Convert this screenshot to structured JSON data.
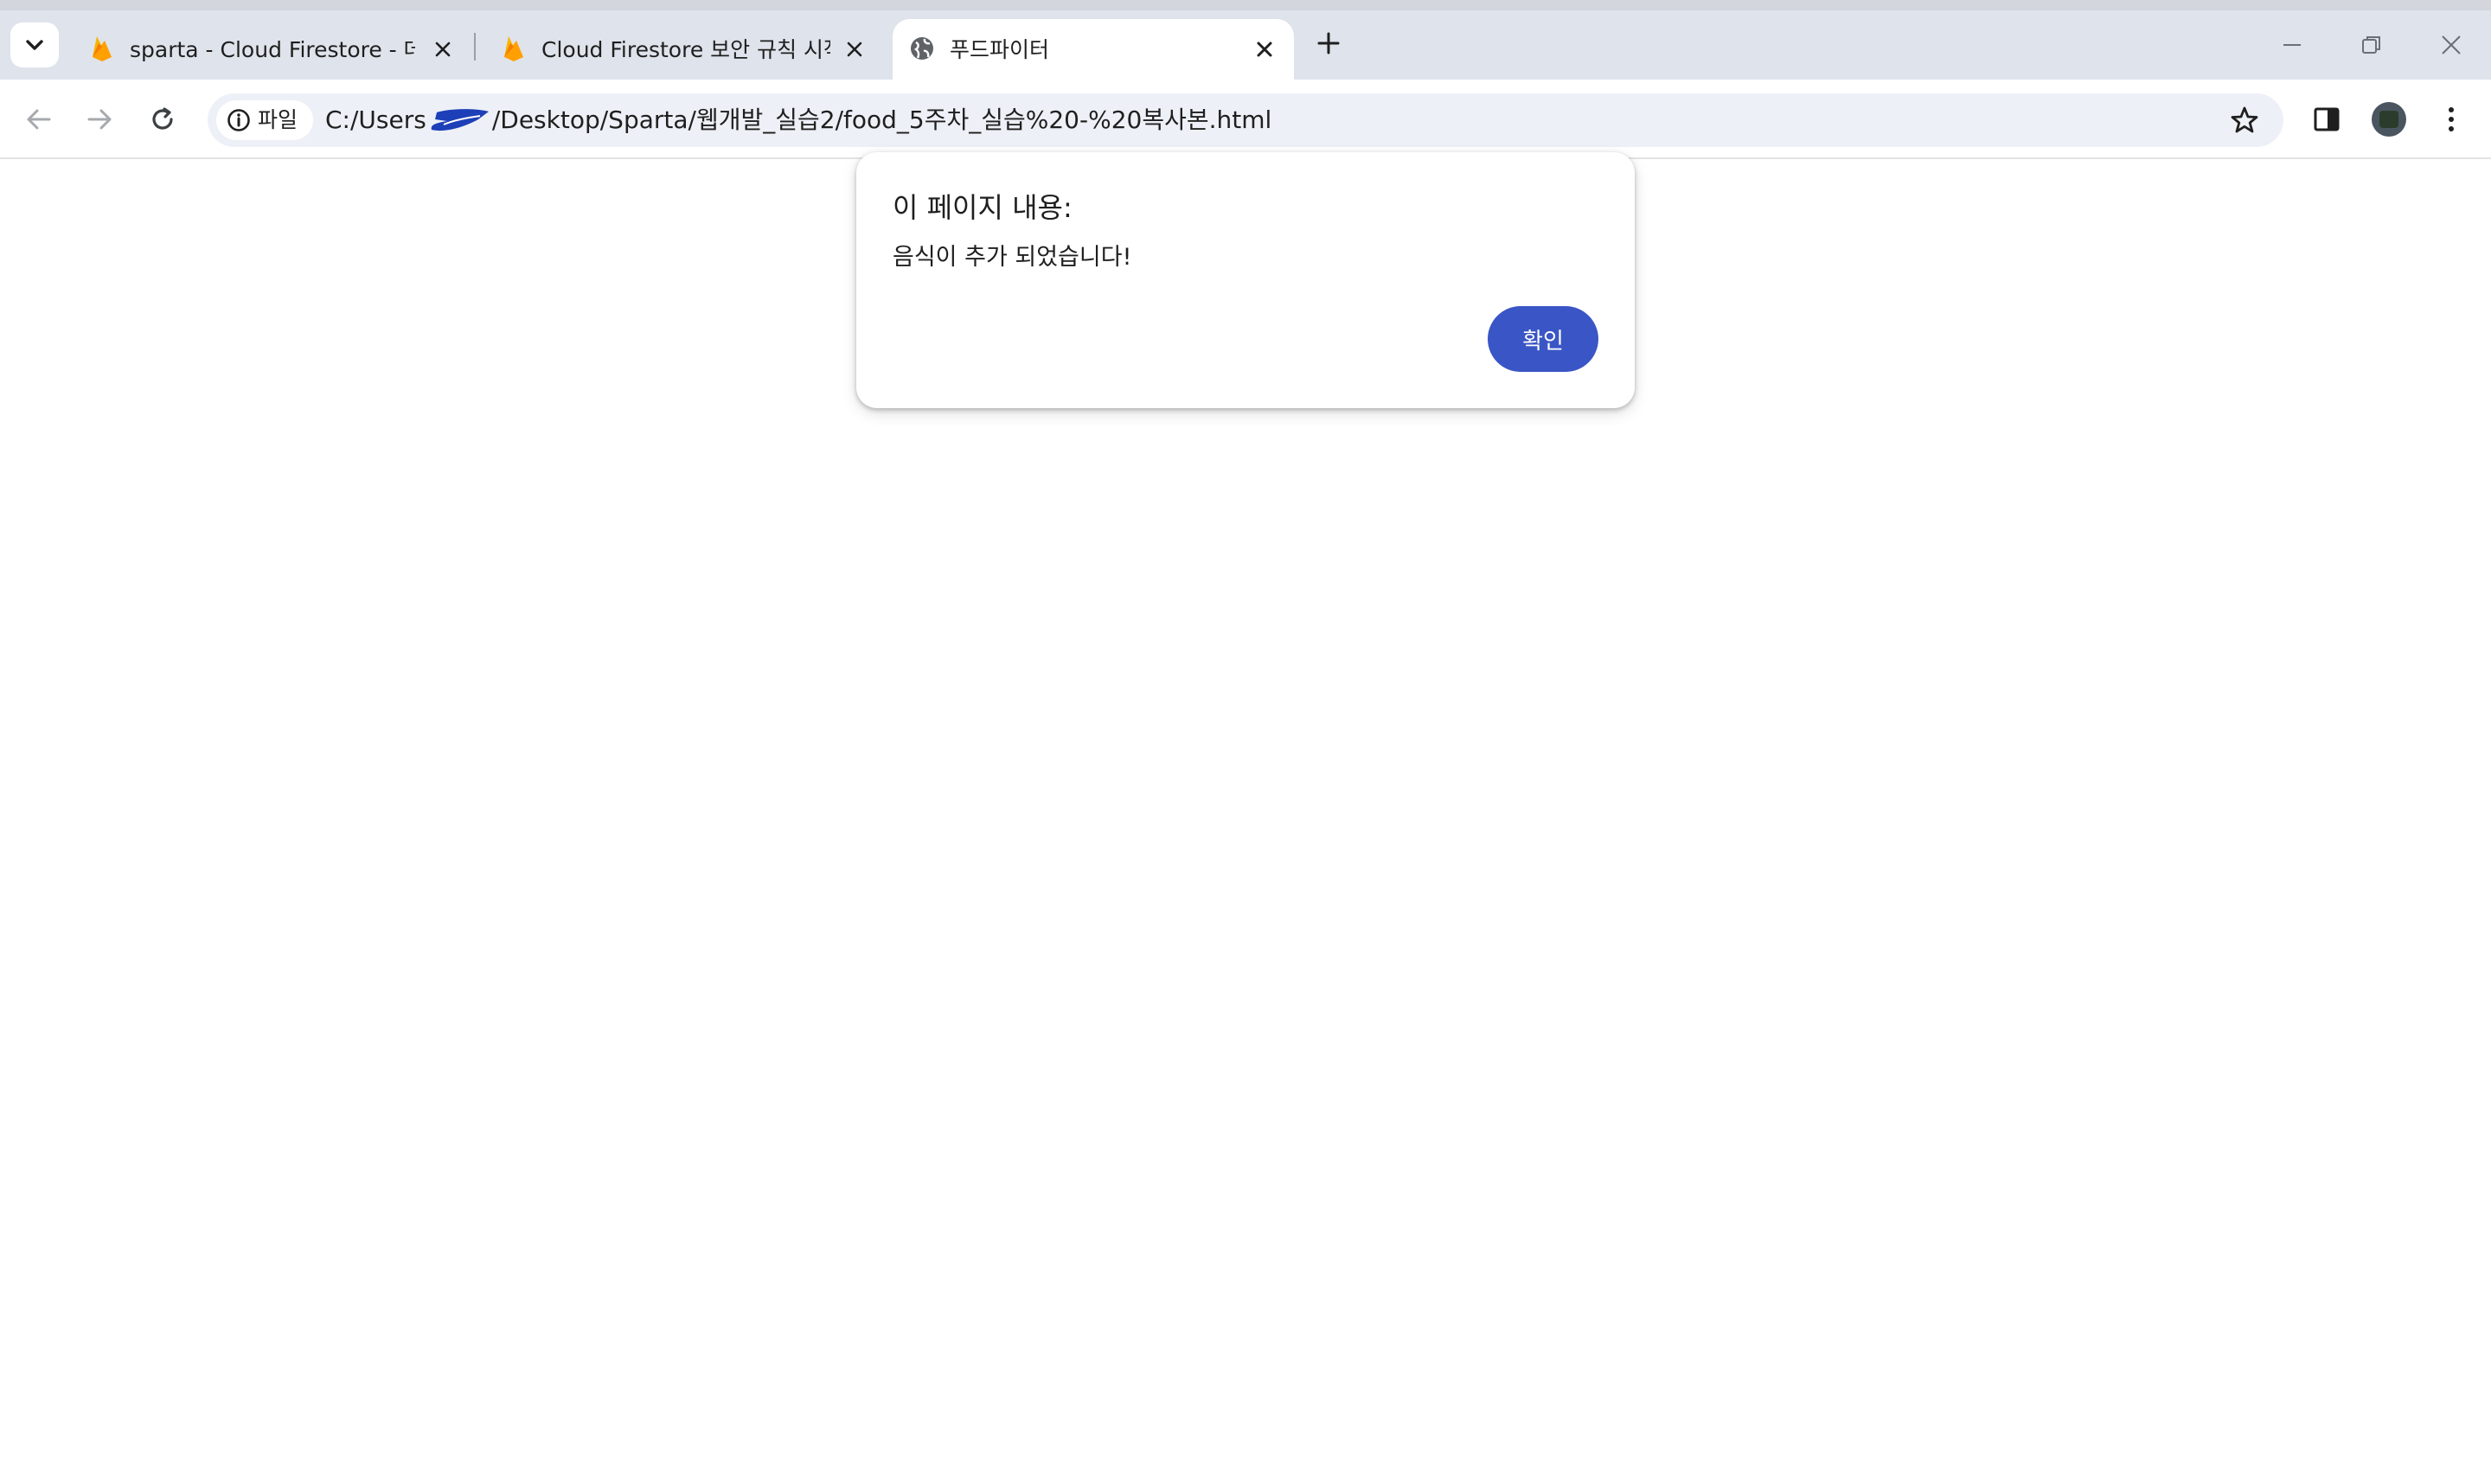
{
  "colors": {
    "tabstrip_bg": "#dfe3eb",
    "omnibox_bg": "#edf0f6",
    "dialog_button_bg": "#3a55c5",
    "firebase_flame": "#f6b500"
  },
  "tabs": [
    {
      "title": "sparta - Cloud Firestore - 데이",
      "icon": "firebase-icon",
      "active": false
    },
    {
      "title": "Cloud Firestore 보안 규칙 시작",
      "icon": "firebase-icon",
      "active": false
    },
    {
      "title": "푸드파이터",
      "icon": "globe-icon",
      "active": true
    }
  ],
  "toolbar": {
    "site_chip_label": "파일",
    "url_prefix": "C:/Users",
    "url_suffix": "/Desktop/Sparta/웹개발_실습2/food_5주차_실습%20-%20복사본.html"
  },
  "dialog": {
    "title": "이 페이지 내용:",
    "message": "음식이 추가 되었습니다!",
    "ok_label": "확인"
  }
}
